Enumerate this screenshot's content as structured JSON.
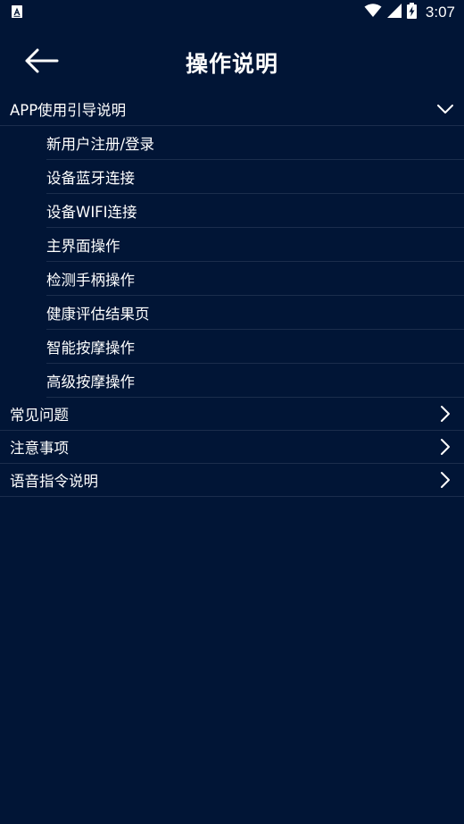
{
  "status_bar": {
    "time": "3:07",
    "icons": [
      "notification-a-icon",
      "wifi-icon",
      "signal-icon",
      "battery-charging-icon"
    ]
  },
  "header": {
    "title": "操作说明",
    "back_icon": "arrow-left-icon"
  },
  "sections": [
    {
      "label": "APP使用引导说明",
      "expanded": true,
      "items": [
        "新用户注册/登录",
        "设备蓝牙连接",
        "设备WIFI连接",
        "主界面操作",
        "检测手柄操作",
        "健康评估结果页",
        "智能按摩操作",
        "高级按摩操作"
      ]
    },
    {
      "label": "常见问题",
      "expanded": false
    },
    {
      "label": "注意事项",
      "expanded": false
    },
    {
      "label": "语音指令说明",
      "expanded": false
    }
  ],
  "colors": {
    "background": "#011536",
    "divider": "#1b2d4c",
    "text": "#ffffff"
  }
}
